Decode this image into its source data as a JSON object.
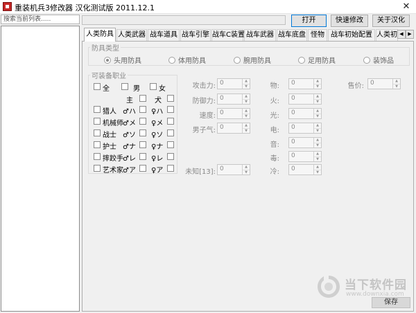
{
  "window": {
    "title": "重装机兵3修改器 汉化测试版  2011.12.1",
    "close_glyph": "✕"
  },
  "search": {
    "placeholder": "搜索当前列表....."
  },
  "toolbar": {
    "open_label": "打开",
    "quick_edit_label": "快速修改",
    "about_label": "关于汉化"
  },
  "tabs": [
    {
      "label": "人类防具",
      "active": true
    },
    {
      "label": "人类武器"
    },
    {
      "label": "战车道具"
    },
    {
      "label": "战车引擎"
    },
    {
      "label": "战车C装置"
    },
    {
      "label": "战车武器"
    },
    {
      "label": "战车底盘"
    },
    {
      "label": "怪物"
    },
    {
      "label": "战车初始配置"
    },
    {
      "label": "人类初"
    }
  ],
  "tab_scroll": {
    "left": "◀",
    "right": "▶"
  },
  "armor_type": {
    "legend": "防具类型",
    "options": [
      {
        "label": "头用防具",
        "checked": true
      },
      {
        "label": "体用防具"
      },
      {
        "label": "腕用防具"
      },
      {
        "label": "足用防具"
      },
      {
        "label": "装饰品"
      }
    ]
  },
  "jobs": {
    "legend": "可装备职业",
    "all_label": "全",
    "male_label": "男",
    "female_label": "女",
    "master_label": "主",
    "dog_label": "犬",
    "rows": [
      {
        "label": "猎人",
        "male": "♂ハ",
        "female": "♀ハ"
      },
      {
        "label": "机械师",
        "male": "♂メ",
        "female": "♀メ"
      },
      {
        "label": "战士",
        "male": "♂ソ",
        "female": "♀ソ"
      },
      {
        "label": "护士",
        "male": "♂ナ",
        "female": "♀ナ"
      },
      {
        "label": "摔跤手",
        "male": "♂レ",
        "female": "♀レ"
      },
      {
        "label": "艺术家",
        "male": "♂ア",
        "female": "♀ア"
      }
    ]
  },
  "stats": {
    "attack": {
      "label": "攻击力:",
      "value": "0"
    },
    "defense": {
      "label": "防御力:",
      "value": "0"
    },
    "speed": {
      "label": "速度:",
      "value": "0"
    },
    "manliness": {
      "label": "男子气:",
      "value": "0"
    },
    "unknown13": {
      "label": "未知[13]:",
      "value": "0"
    }
  },
  "resist": {
    "physical": {
      "label": "物:",
      "value": "0"
    },
    "fire": {
      "label": "火:",
      "value": "0"
    },
    "light": {
      "label": "光:",
      "value": "0"
    },
    "electric": {
      "label": "电:",
      "value": "0"
    },
    "sound": {
      "label": "音:",
      "value": "0"
    },
    "poison": {
      "label": "毒:",
      "value": "0"
    },
    "cold": {
      "label": "冷:",
      "value": "0"
    }
  },
  "price": {
    "label": "售价:",
    "value": "0"
  },
  "save_label": "保存",
  "watermark": {
    "name": "当下软件园",
    "url": "www.downxia.com"
  },
  "colors": {
    "accent": "#0078d7",
    "brand_red": "#c62828",
    "watermark": "#c4c4c4"
  }
}
